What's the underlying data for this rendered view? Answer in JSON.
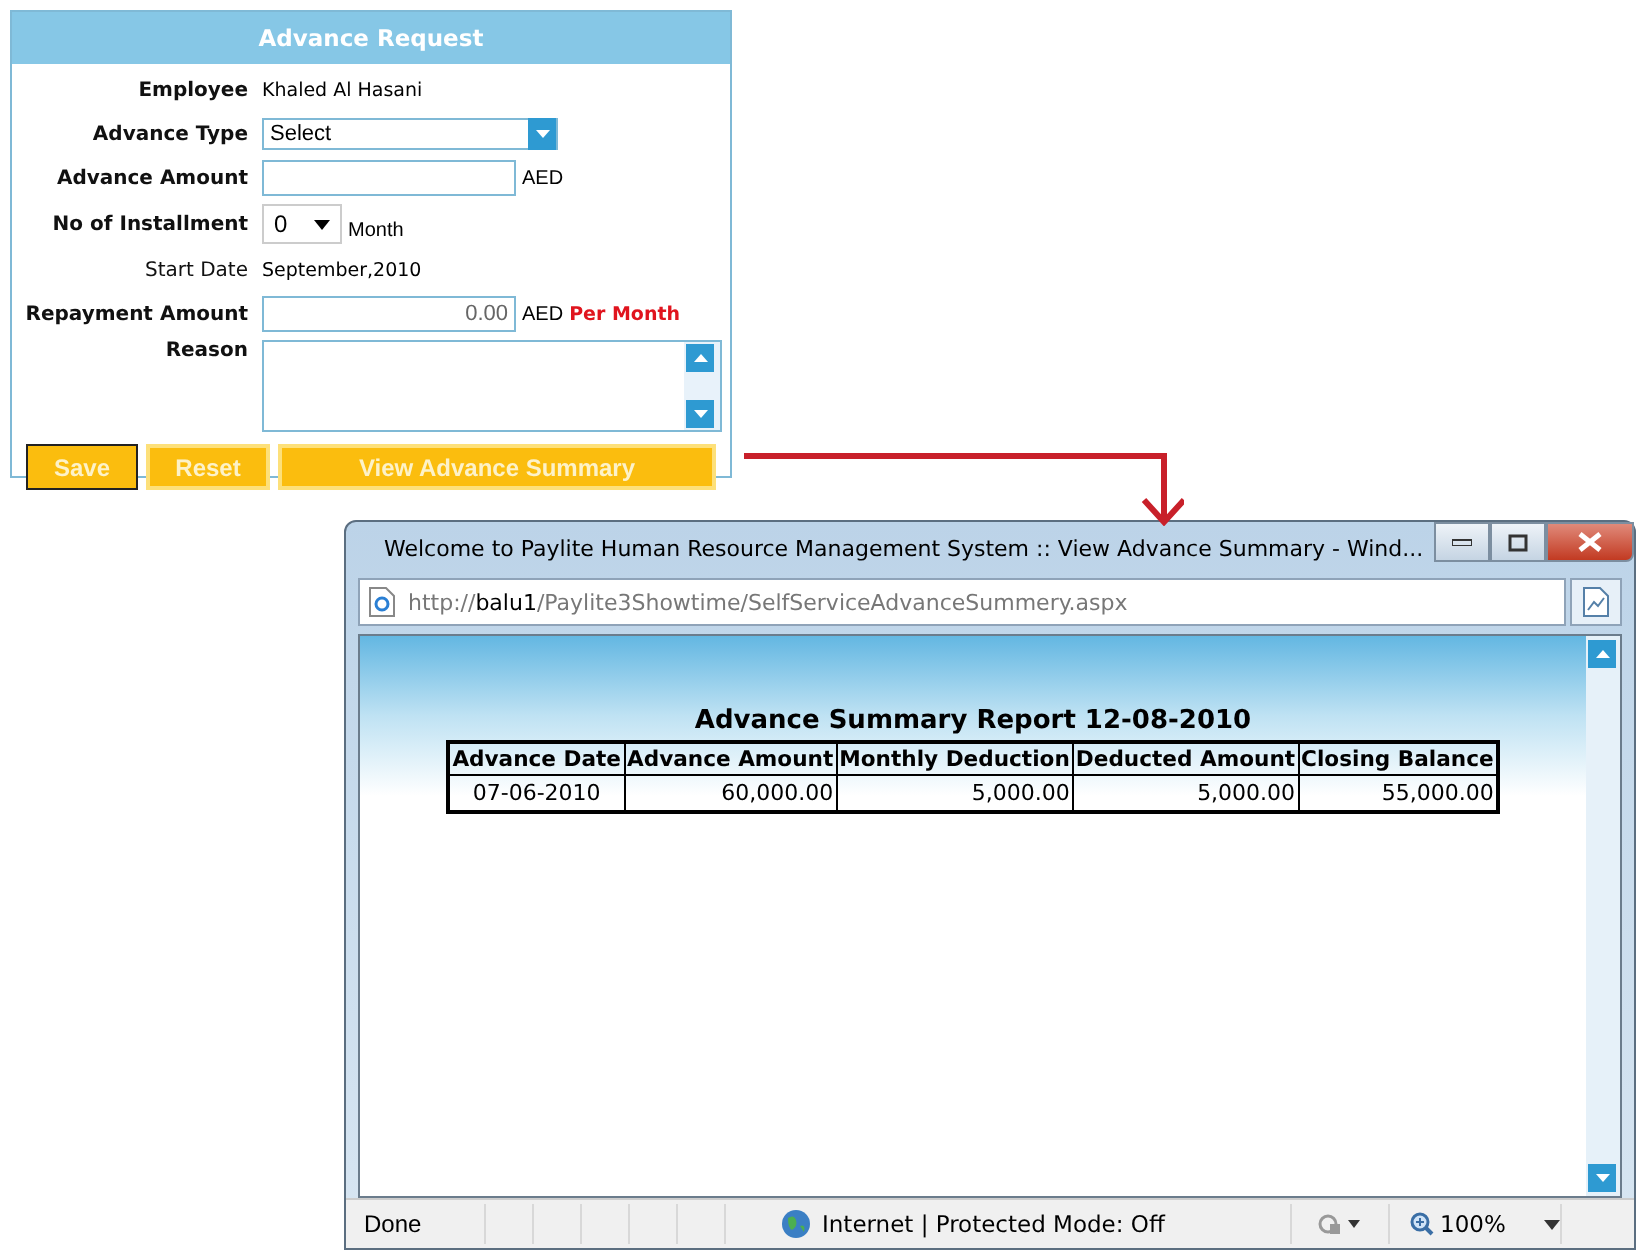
{
  "form": {
    "title": "Advance Request",
    "rows": [
      {
        "kind": "text",
        "label": "Employee",
        "label_bold": true,
        "value": "Khaled Al Hasani"
      },
      {
        "kind": "select",
        "label": "Advance Type",
        "label_bold": true,
        "value": "Select"
      },
      {
        "kind": "input",
        "label": "Advance Amount",
        "label_bold": true,
        "unit": "AED"
      },
      {
        "kind": "small-select",
        "label": "No of Installment",
        "label_bold": true,
        "value": "0",
        "unit": "Month"
      },
      {
        "kind": "text",
        "label": "Start Date",
        "label_bold": false,
        "value": "September,2010"
      },
      {
        "kind": "input",
        "label": "Repayment Amount",
        "label_bold": true,
        "value": "0.00",
        "unit": "AED",
        "note": "Per Month"
      },
      {
        "kind": "textarea",
        "label": "Reason",
        "label_bold": true
      }
    ],
    "buttons": [
      {
        "label": "Save",
        "focused": true
      },
      {
        "label": "Reset",
        "focused": false
      },
      {
        "label": "View Advance Summary",
        "focused": false
      }
    ]
  },
  "browser": {
    "title": "Welcome to Paylite Human Resource Management System :: View Advance Summary - Wind...",
    "address": {
      "scheme": "http://",
      "host": "balu1",
      "path": "/Paylite3Showtime/SelfServiceAdvanceSummery.aspx"
    },
    "report": {
      "title": "Advance Summary Report 12-08-2010",
      "columns": [
        "Advance Date",
        "Advance Amount",
        "Monthly Deduction",
        "Deducted Amount",
        "Closing Balance"
      ],
      "rows": [
        [
          "07-06-2010",
          "60,000.00",
          "5,000.00",
          "5,000.00",
          "55,000.00"
        ]
      ]
    },
    "status_bar": {
      "status": "Done",
      "zone": "Internet | Protected Mode: Off",
      "zoom": "100%"
    }
  }
}
